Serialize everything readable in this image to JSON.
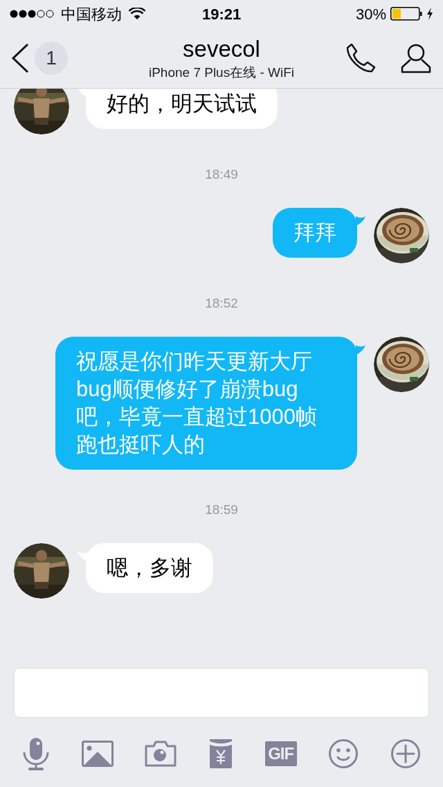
{
  "status_bar": {
    "carrier": "中国移动",
    "time": "19:21",
    "battery": "30%"
  },
  "nav_bar": {
    "badge": "1",
    "title": "sevecol",
    "subtitle": "iPhone 7 Plus在线 - WiFi"
  },
  "messages": [
    {
      "kind": "message",
      "outgoing": false,
      "text": "好的，明天试试"
    },
    {
      "kind": "time",
      "text": "18:49"
    },
    {
      "kind": "message",
      "outgoing": true,
      "text": "拜拜"
    },
    {
      "kind": "time",
      "text": "18:52"
    },
    {
      "kind": "message",
      "outgoing": true,
      "text": "祝愿是你们昨天更新大厅bug顺便修好了崩溃bug吧，毕竟一直超过1000帧跑也挺吓人的"
    },
    {
      "kind": "time",
      "text": "18:59"
    },
    {
      "kind": "message",
      "outgoing": false,
      "text": "嗯，多谢"
    }
  ],
  "toolbar": {
    "gif_label": "GIF"
  }
}
